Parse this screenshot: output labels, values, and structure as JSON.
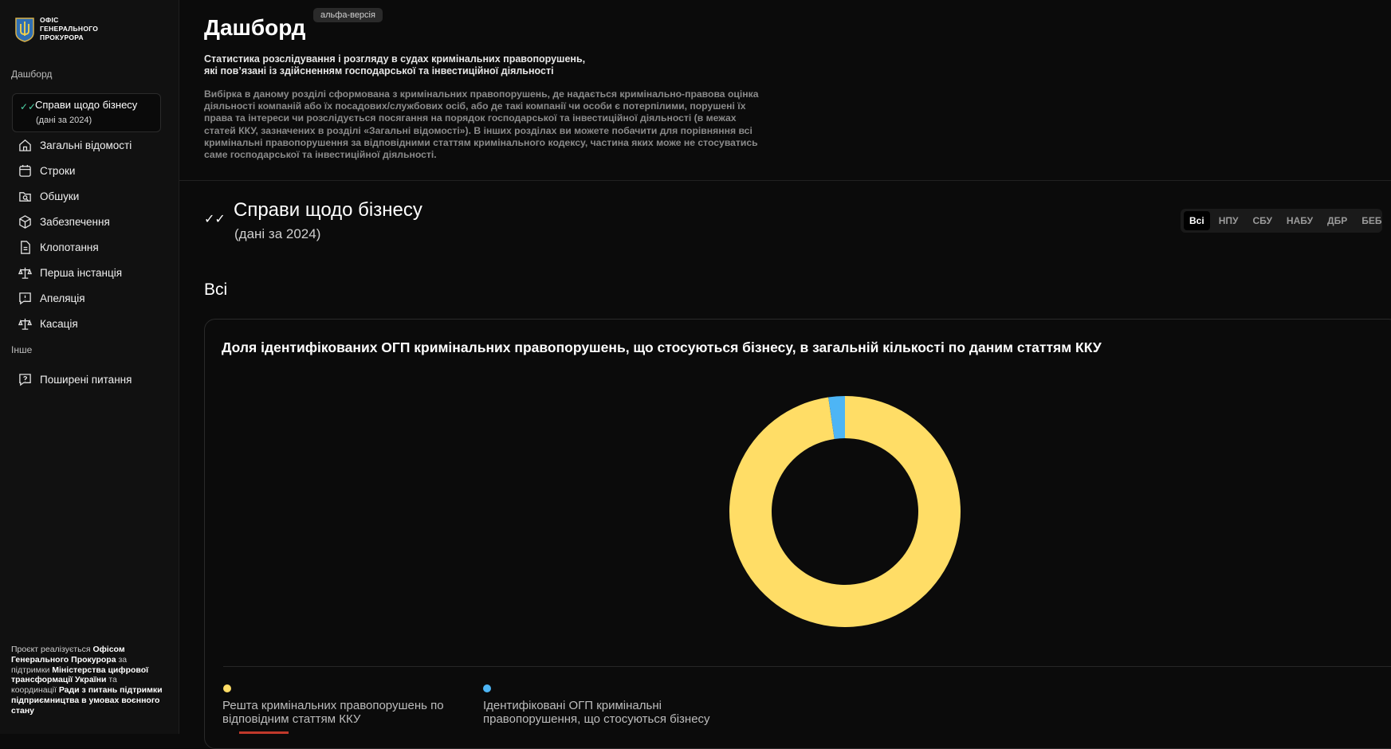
{
  "logo": {
    "text": "ОФІС ГЕНЕРАЛЬНОГО ПРОКУРОРА"
  },
  "sidebar": {
    "section_dashboard": "Дашборд",
    "active_item": {
      "label": "Справи щодо бізнесу",
      "sub": "(дані за 2024)"
    },
    "items": [
      {
        "label": "Загальні відомості",
        "icon": "home-icon"
      },
      {
        "label": "Строки",
        "icon": "calendar-icon"
      },
      {
        "label": "Обшуки",
        "icon": "search-folder-icon"
      },
      {
        "label": "Забезпечення",
        "icon": "box-icon"
      },
      {
        "label": "Клопотання",
        "icon": "document-icon"
      },
      {
        "label": "Перша інстанція",
        "icon": "scales-icon"
      },
      {
        "label": "Апеляція",
        "icon": "alert-message-icon"
      },
      {
        "label": "Касація",
        "icon": "scales-icon"
      }
    ],
    "section_other": "Інше",
    "other_items": [
      {
        "label": "Поширені питання",
        "icon": "question-icon"
      }
    ],
    "footer": {
      "p1": "Проєкт реалізується ",
      "b1": "Офісом Генерального Прокурора",
      "p2": " за підтримки ",
      "b2": "Міністерства цифрової трансформації України",
      "p3": " та координації ",
      "b3": "Ради з питань підтримки підприємництва в умовах воєнного стану"
    }
  },
  "header": {
    "title": "Дашборд",
    "badge": "альфа-версія",
    "subtitle_line1": "Статистика розслідування і розгляду в судах кримінальних правопорушень,",
    "subtitle_line2": "які пов’язані із здійсненням господарської та інвестиційної діяльності",
    "description": "Вибірка в даному розділі сформована з кримінальних правопорушень, де надається кримінально-правова оцінка діяльності компаній або їх посадових/службових осіб, або де такі компанії чи особи є потерпілими, порушені їх права та інтереси чи розслідується посягання на порядок господарської та інвестиційної діяльності (в межах статей ККУ, зазначених в розділі «Загальні відомості»). В інших розділах ви можете побачити для порівняння всі кримінальні правопорушення за відповідними статтям кримінального кодексу, частина яких може не стосуватись саме господарської та інвестиційної діяльності."
  },
  "section": {
    "title": "Справи щодо бізнесу",
    "subtitle": "(дані за 2024)",
    "filters": [
      "Всі",
      "НПУ",
      "СБУ",
      "НАБУ",
      "ДБР",
      "БЕБ"
    ],
    "active_filter": "Всі",
    "group_title": "Всі"
  },
  "card": {
    "title": "Доля ідентифікованих ОГП кримінальних правопорушень, що стосуються бізнесу, в загальній кількості по даним статтям ККУ"
  },
  "chart_data": {
    "type": "pie",
    "title": "Доля ідентифікованих ОГП кримінальних правопорушень, що стосуються бізнесу, в загальній кількості по даним статтям ККУ",
    "donut": true,
    "series": [
      {
        "name": "Решта кримінальних правопорушень по відповідним статтям ККУ",
        "value": 97.7,
        "color": "#ffdd66"
      },
      {
        "name": "Ідентифіковані ОГП кримінальні правопорушення, що стосуються бізнесу",
        "value": 2.3,
        "color": "#4db5f5"
      }
    ],
    "legend_position": "bottom"
  },
  "colors": {
    "accent_yellow": "#ffdd66",
    "accent_blue": "#4db5f5",
    "accent_green": "#4fd6a8"
  }
}
